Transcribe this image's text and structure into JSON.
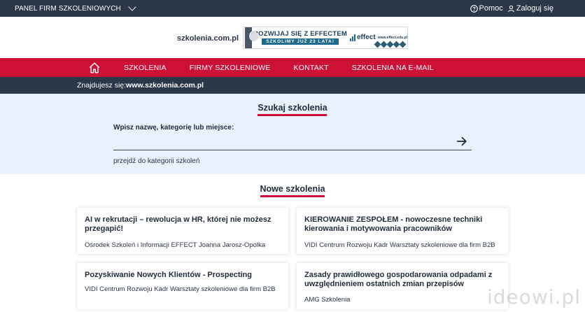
{
  "topbar": {
    "panel_label": "PANEL FIRM SZKOLENIOWYCH",
    "help_label": "Pomoc",
    "login_label": "Zaloguj się"
  },
  "header": {
    "site_name": "szkolenia.com.pl",
    "banner": {
      "headline": "ROZWIJAJ SIĘ Z EFFECTEM",
      "subline": "SZKOLIMY JUŻ 23 LATA!",
      "brand": "effect",
      "url": "www.effect.edu.pl"
    }
  },
  "nav": {
    "items": [
      "SZKOLENIA",
      "FIRMY SZKOLENIOWE",
      "KONTAKT",
      "SZKOLENIA NA E-MAIL"
    ]
  },
  "breadcrumb": {
    "prefix": "Znajdujesz się:",
    "current": "www.szkolenia.com.pl"
  },
  "search": {
    "title": "Szukaj szkolenia",
    "label": "Wpisz nazwę, kategorię lub miejsce:",
    "value": "",
    "category_link": "przejdź do kategorii szkoleń"
  },
  "new_trainings": {
    "title": "Nowe szkolenia",
    "cards": [
      {
        "title": "AI w rekrutacji – rewolucja w HR, której nie możesz przegapić!",
        "org": "Ośrodek Szkoleń i Informacji EFFECT Joanna Jarosz-Opolka"
      },
      {
        "title": "KIEROWANIE ZESPOŁEM - nowoczesne techniki kierowania i motywowania pracowników",
        "org": "VIDI Centrum Rozwoju Kadr Warsztaty szkoleniowe dla firm B2B"
      },
      {
        "title": "Pozyskiwanie Nowych Klientów - Prospecting",
        "org": "VIDI Centrum Rozwoju Kadr Warsztaty szkoleniowe dla firm B2B"
      },
      {
        "title": "Zasady prawidłowego gospodarowania odpadami z uwzględnieniem ostatnich zmian przepisów",
        "org": "AMG Szkolenia"
      }
    ]
  },
  "watermark": "ideowi.pl",
  "colors": {
    "dark": "#2b3648",
    "accent": "#cc1036",
    "search_bg": "#e8f2fc"
  },
  "icons": {
    "panel_toggle": "chevron-down-icon",
    "help": "help-circle-icon",
    "login": "user-icon",
    "home": "home-icon",
    "search_submit": "arrow-right-icon"
  }
}
